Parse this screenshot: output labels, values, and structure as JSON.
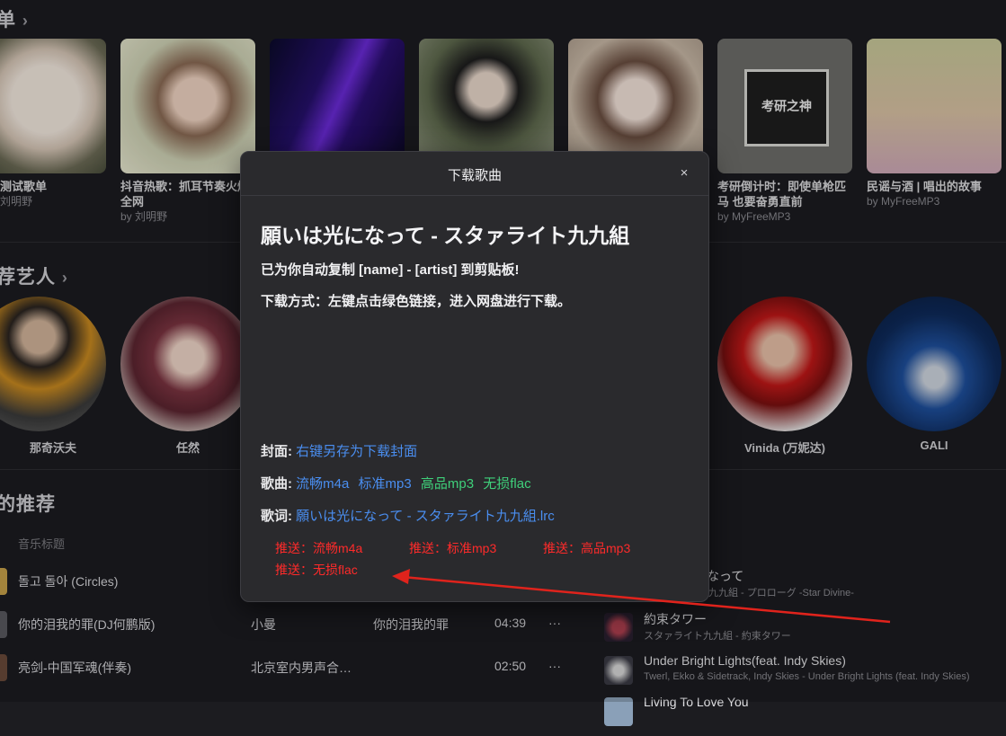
{
  "playlists": {
    "title_fragment": "单",
    "items": [
      {
        "title": "测试歌单",
        "subtitle": "刘明野"
      },
      {
        "title": "抖音热歌：抓耳节奏火爆全网",
        "subtitle": "by 刘明野"
      },
      {
        "title": "",
        "subtitle": ""
      },
      {
        "title": "",
        "subtitle": ""
      },
      {
        "title": "",
        "subtitle": ""
      },
      {
        "title": "考研倒计时：即使单枪匹马 也要奋勇直前",
        "subtitle": "by MyFreeMP3"
      },
      {
        "title": "民谣与酒 | 唱出的故事",
        "subtitle": "by MyFreeMP3"
      }
    ],
    "cover_text_6": "考研之神"
  },
  "artists": {
    "title_fragment": "荐艺人",
    "items": [
      {
        "name": "那奇沃夫"
      },
      {
        "name": "任然"
      },
      {
        "name": "Vinida (万妮达)"
      },
      {
        "name": "GALI"
      }
    ]
  },
  "songs": {
    "title_fragment": "的推荐",
    "column_title": "音乐标题",
    "rows": [
      {
        "title": "돌고 돌아 (Circles)",
        "artist": "",
        "album": "",
        "duration": ""
      },
      {
        "title": "你的泪我的罪(DJ何鹏版)",
        "artist": "小曼",
        "album": "你的泪我的罪",
        "duration": "04:39"
      },
      {
        "title": "亮剑-中国军魂(伴奏)",
        "artist": "北京室内男声合…",
        "album": "",
        "duration": "02:50"
      }
    ],
    "more_label": "···"
  },
  "right_list": [
    {
      "title": "なって",
      "subtitle": "九九組 - プロローグ -Star Divine-"
    },
    {
      "title": "約束タワー",
      "subtitle": "スタァライト九九組 - 約束タワー"
    },
    {
      "title": "Under Bright Lights(feat. Indy Skies)",
      "subtitle": "Twerl, Ekko & Sidetrack, Indy Skies - Under Bright Lights (feat. Indy Skies)"
    },
    {
      "title": "Living To Love You",
      "subtitle": ""
    }
  ],
  "dialog": {
    "title": "下载歌曲",
    "close": "×",
    "song": "願いは光になって - スタァライト九九組",
    "copied_note": "已为你自动复制 [name] - [artist] 到剪贴板!",
    "method_note": "下载方式：左键点击绿色链接，进入网盘进行下载。",
    "cover_label": "封面:",
    "cover_link": "右键另存为下载封面",
    "song_label": "歌曲:",
    "song_links": [
      "流畅m4a",
      "标准mp3",
      "高品mp3",
      "无损flac"
    ],
    "lyric_label": "歌词:",
    "lyric_link": "願いは光になって - スタァライト九九組.lrc",
    "push_links": [
      "推送：流畅m4a",
      "推送：标准mp3",
      "推送：高品mp3",
      "推送：无损flac"
    ]
  },
  "colors": {
    "accent_blue": "#4a8ef0",
    "accent_green": "#3fd07a",
    "accent_red": "#ff2a2a",
    "background": "#1c1c20",
    "dialog": "#2a2a2d"
  }
}
